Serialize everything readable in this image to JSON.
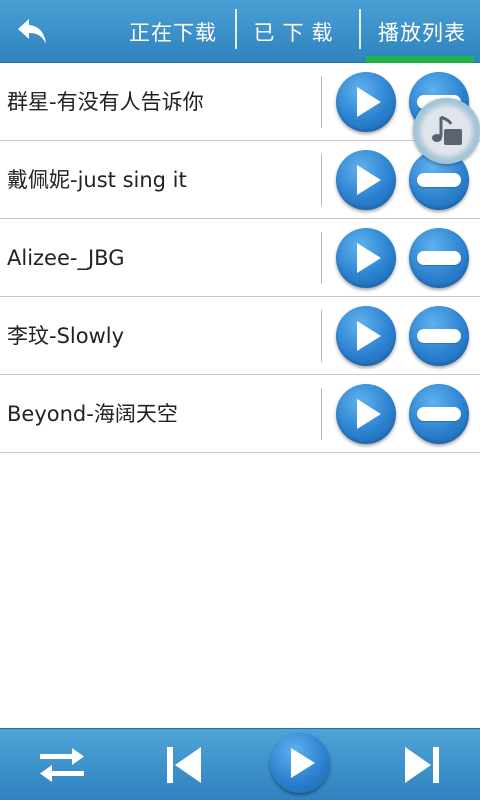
{
  "header": {
    "back_icon": "back-arrow-icon",
    "tabs": [
      {
        "label": "正在下载"
      },
      {
        "label": "已下载"
      },
      {
        "label": "播放列表",
        "active": true
      }
    ],
    "active_indicator_color": "#1db34a"
  },
  "playlist": {
    "items": [
      {
        "title": "群星-有没有人告诉你"
      },
      {
        "title": "戴佩妮-just sing it"
      },
      {
        "title": "Alizee-_JBG"
      },
      {
        "title": "李玟-Slowly"
      },
      {
        "title": "Beyond-海阔天空"
      }
    ],
    "play_icon": "play-icon",
    "remove_icon": "remove-icon"
  },
  "floating_player": {
    "icon": "music-note-icon"
  },
  "controls": {
    "shuffle_icon": "shuffle-icon",
    "prev_icon": "previous-icon",
    "play_icon": "play-icon",
    "next_icon": "next-icon"
  },
  "colors": {
    "bar_blue": "#3a8fcc",
    "button_blue": "#2c82d0"
  }
}
